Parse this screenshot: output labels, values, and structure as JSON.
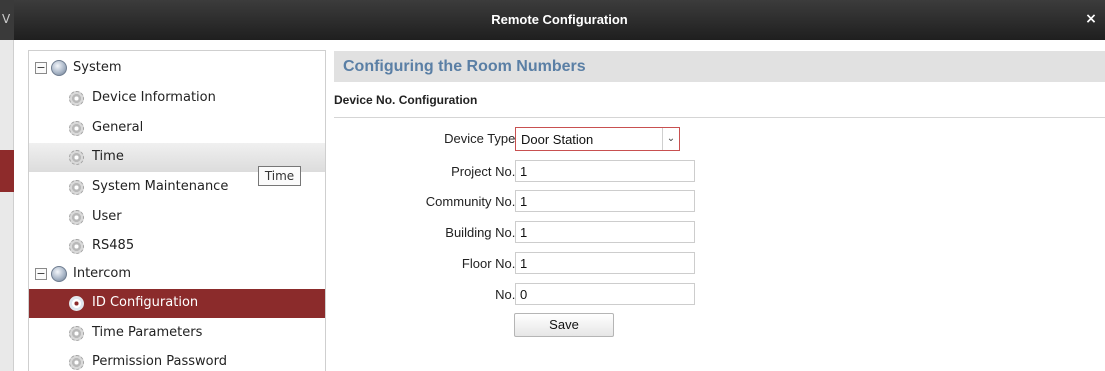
{
  "window": {
    "title": "Remote Configuration",
    "close_glyph": "×"
  },
  "background": {
    "edge_glyph": "V"
  },
  "tree": {
    "groups": [
      {
        "label": "System",
        "toggle": "−"
      },
      {
        "label": "Intercom",
        "toggle": "−"
      }
    ],
    "items": [
      {
        "label": "Device Information"
      },
      {
        "label": "General"
      },
      {
        "label": "Time"
      },
      {
        "label": "System Maintenance"
      },
      {
        "label": "User"
      },
      {
        "label": "RS485"
      },
      {
        "label": "ID Configuration"
      },
      {
        "label": "Time Parameters"
      },
      {
        "label": "Permission Password"
      }
    ],
    "selected_item": "ID Configuration",
    "hovered_item": "Time",
    "tooltip": "Time"
  },
  "main": {
    "section_title": "Configuring the Room Numbers",
    "subheading": "Device No. Configuration",
    "fields": {
      "device_type": {
        "label": "Device Type:",
        "value": "Door Station"
      },
      "project_no": {
        "label": "Project No.:",
        "value": "1"
      },
      "community_no": {
        "label": "Community No.:",
        "value": "1"
      },
      "building_no": {
        "label": "Building No.:",
        "value": "1"
      },
      "floor_no": {
        "label": "Floor No.:",
        "value": "1"
      },
      "no": {
        "label": "No.:",
        "value": "0"
      }
    },
    "save_label": "Save"
  },
  "colors": {
    "title_bar": "#2b2b2b",
    "selected_item": "#8b2b2b",
    "section_title_text": "#5a7fa5",
    "section_header_bg": "#e1e1e1",
    "select_border": "#c85050"
  },
  "icons": {
    "group": "gear-globe-icon",
    "item": "gear-icon",
    "toggle": "collapse-icon",
    "dropdown": "chevron-down-icon",
    "close": "close-icon"
  }
}
